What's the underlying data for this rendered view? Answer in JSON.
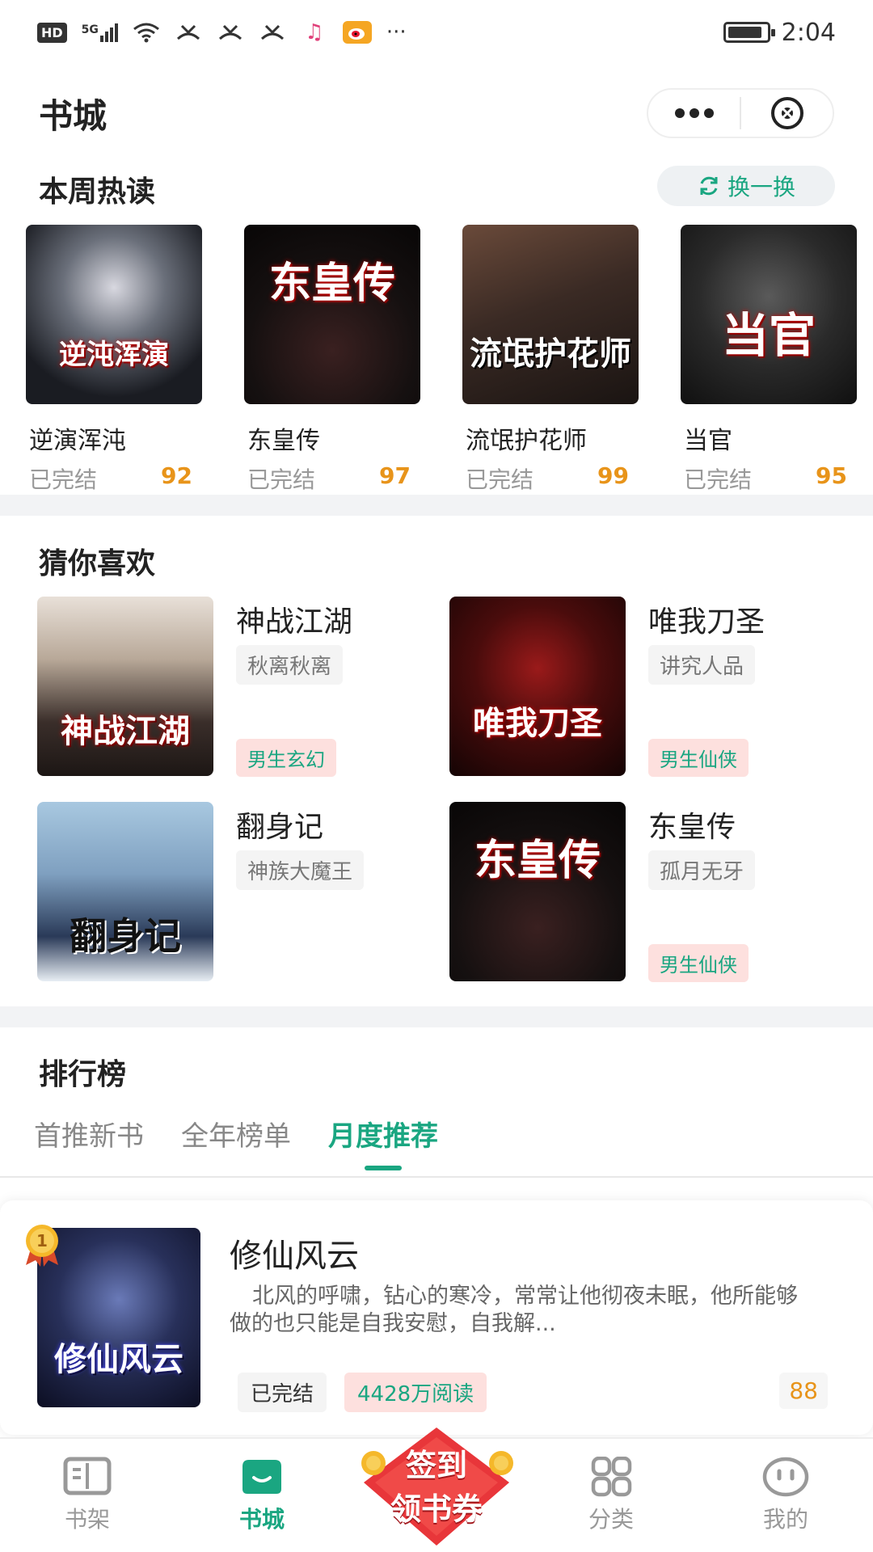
{
  "status_bar": {
    "hd": "HD",
    "network": "5G",
    "time": "2:04",
    "more": "···",
    "battery_level": 0.9
  },
  "header": {
    "title": "书城"
  },
  "hot": {
    "title": "本周热读",
    "refresh_label": "换一换",
    "items": [
      {
        "cover_text": "逆沌浑演",
        "name": "逆演浑沌",
        "status": "已完结",
        "score": "92"
      },
      {
        "cover_text": "东皇传",
        "name": "东皇传",
        "status": "已完结",
        "score": "97"
      },
      {
        "cover_text": "流氓护花师",
        "name": "流氓护花师",
        "status": "已完结",
        "score": "99"
      },
      {
        "cover_text": "当官",
        "name": "当官",
        "status": "已完结",
        "score": "95"
      }
    ]
  },
  "guess": {
    "title": "猜你喜欢",
    "items": [
      {
        "cover_text": "神战江湖",
        "title": "神战江湖",
        "author": "秋离秋离",
        "tag": "男生玄幻"
      },
      {
        "cover_text": "唯我刀圣",
        "title": "唯我刀圣",
        "author": "讲究人品",
        "tag": "男生仙侠"
      },
      {
        "cover_text": "翻身记",
        "title": "翻身记",
        "author": "神族大魔王",
        "tag": ""
      },
      {
        "cover_text": "东皇传",
        "title": "东皇传",
        "author": "孤月无牙",
        "tag": "男生仙侠"
      }
    ]
  },
  "ranking": {
    "title": "排行榜",
    "tabs": [
      "首推新书",
      "全年榜单",
      "月度推荐"
    ],
    "active_tab": 2,
    "top_item": {
      "medal": "1",
      "cover_text": "修仙风云",
      "title": "修仙风云",
      "description": "北风的呼啸，钻心的寒冷，常常让他彻夜未眠，他所能够做的也只能是自我安慰，自我解...",
      "status": "已完结",
      "reads": "4428万阅读",
      "score": "88"
    }
  },
  "bottom_nav": {
    "items": [
      {
        "label": "书架",
        "icon": "book-open-icon"
      },
      {
        "label": "书城",
        "icon": "store-icon"
      },
      {
        "label": "分类",
        "icon": "grid-icon"
      },
      {
        "label": "我的",
        "icon": "profile-icon"
      }
    ],
    "signin_line1": "签到",
    "signin_line2": "领书券"
  },
  "colors": {
    "accent": "#1aa681",
    "score": "#e8941a",
    "tag_bg": "#fde0de"
  }
}
